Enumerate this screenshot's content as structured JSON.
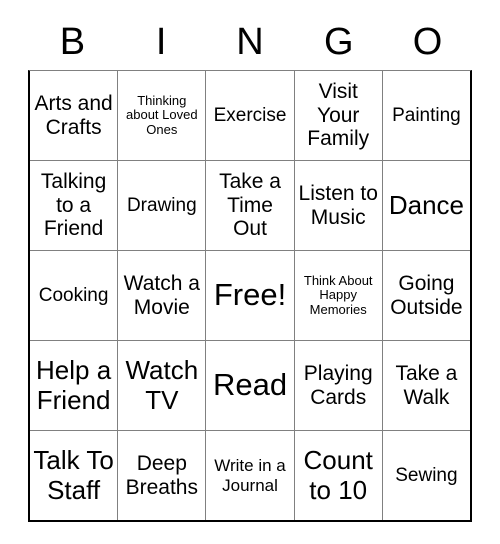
{
  "card": {
    "header": {
      "letters": [
        "B",
        "I",
        "N",
        "G",
        "O"
      ]
    },
    "rows": [
      [
        {
          "text": "Arts and Crafts",
          "size": "lg"
        },
        {
          "text": "Thinking about Loved Ones",
          "size": "xs"
        },
        {
          "text": "Exercise",
          "size": "md"
        },
        {
          "text": "Visit Your Family",
          "size": "lg"
        },
        {
          "text": "Painting",
          "size": "md"
        }
      ],
      [
        {
          "text": "Talking to a Friend",
          "size": "lg"
        },
        {
          "text": "Drawing",
          "size": "md"
        },
        {
          "text": "Take a Time Out",
          "size": "lg"
        },
        {
          "text": "Listen to Music",
          "size": "lg"
        },
        {
          "text": "Dance",
          "size": "xl"
        }
      ],
      [
        {
          "text": "Cooking",
          "size": "md"
        },
        {
          "text": "Watch a Movie",
          "size": "lg"
        },
        {
          "text": "Free!",
          "size": "xxl"
        },
        {
          "text": "Think About Happy Memories",
          "size": "xs"
        },
        {
          "text": "Going Outside",
          "size": "lg"
        }
      ],
      [
        {
          "text": "Help a Friend",
          "size": "xl"
        },
        {
          "text": "Watch TV",
          "size": "xl"
        },
        {
          "text": "Read",
          "size": "xxl"
        },
        {
          "text": "Playing Cards",
          "size": "lg"
        },
        {
          "text": "Take a Walk",
          "size": "lg"
        }
      ],
      [
        {
          "text": "Talk To Staff",
          "size": "xl"
        },
        {
          "text": "Deep Breaths",
          "size": "lg"
        },
        {
          "text": "Write in a Journal",
          "size": "sm"
        },
        {
          "text": "Count to 10",
          "size": "xl"
        },
        {
          "text": "Sewing",
          "size": "md"
        }
      ]
    ]
  }
}
